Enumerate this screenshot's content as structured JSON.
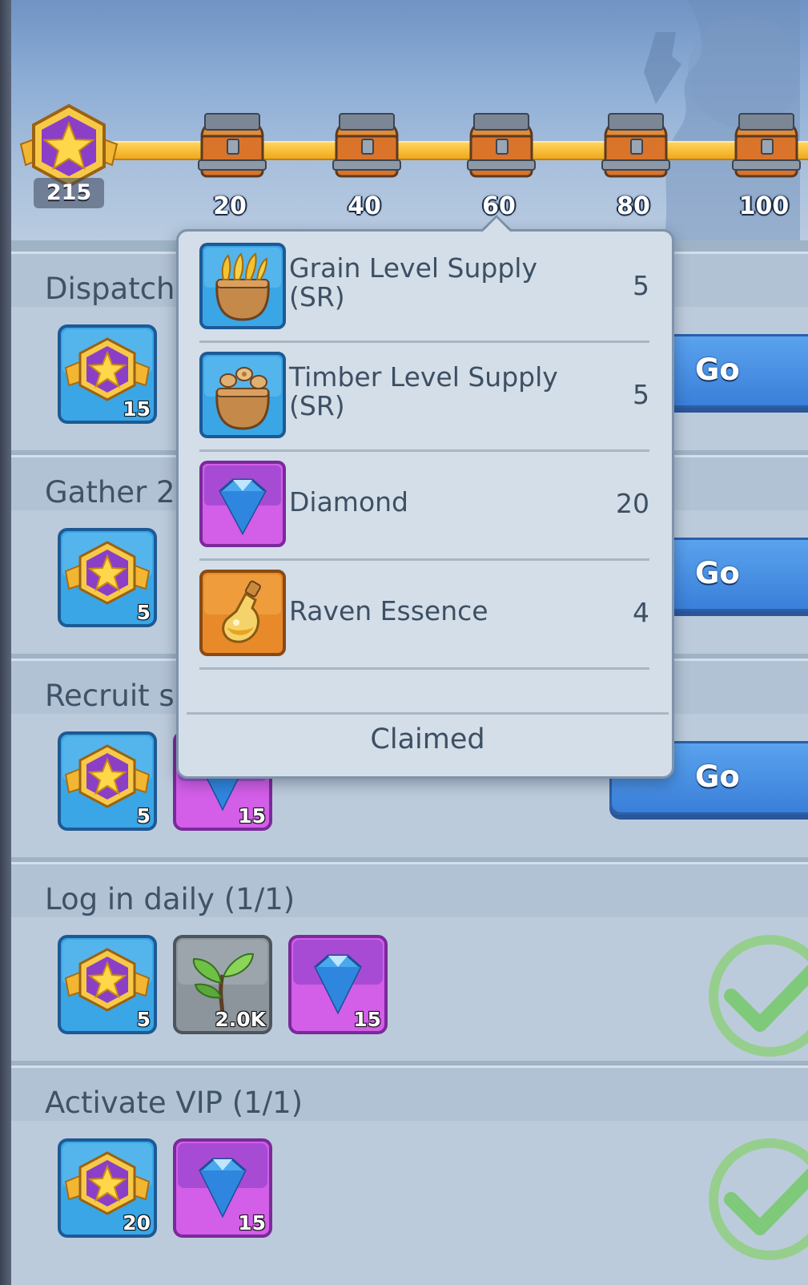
{
  "header": {
    "points": "215",
    "milestones": [
      {
        "label": "20"
      },
      {
        "label": "40"
      },
      {
        "label": "60"
      },
      {
        "label": "80"
      },
      {
        "label": "100"
      }
    ]
  },
  "tasks": [
    {
      "title": "Dispatch",
      "rewards": [
        {
          "icon": "star-medal-icon",
          "count": "15"
        }
      ],
      "action": "Go"
    },
    {
      "title": "Gather 2(",
      "rewards": [
        {
          "icon": "star-medal-icon",
          "count": "5"
        }
      ],
      "action": "Go"
    },
    {
      "title": "Recruit s",
      "rewards": [
        {
          "icon": "star-medal-icon",
          "count": "5"
        },
        {
          "icon": "diamond-icon",
          "count": "15"
        }
      ],
      "action": "Go"
    },
    {
      "title": "Log in daily (1/1)",
      "rewards": [
        {
          "icon": "star-medal-icon",
          "count": "5"
        },
        {
          "icon": "sprout-icon",
          "count": "2.0K"
        },
        {
          "icon": "diamond-icon",
          "count": "15"
        }
      ],
      "status": "completed"
    },
    {
      "title": "Activate VIP (1/1)",
      "rewards": [
        {
          "icon": "star-medal-icon",
          "count": "20"
        },
        {
          "icon": "diamond-icon",
          "count": "15"
        }
      ],
      "status": "completed"
    }
  ],
  "popup": {
    "items": [
      {
        "name": "Grain Level Supply (SR)",
        "line1": "Grain Level Supply",
        "line2": "(SR)",
        "qty": "5",
        "icon": "grain-sack-icon"
      },
      {
        "name": "Timber Level Supply (SR)",
        "line1": "Timber Level Supply",
        "line2": "(SR)",
        "qty": "5",
        "icon": "timber-sack-icon"
      },
      {
        "name": "Diamond",
        "line1": "Diamond",
        "qty": "20",
        "icon": "diamond-icon"
      },
      {
        "name": "Raven Essence",
        "line1": "Raven Essence",
        "qty": "4",
        "icon": "potion-bottle-icon"
      }
    ],
    "status": "Claimed"
  },
  "colors": {
    "go_button": "#3a7fd9",
    "progress_bar": "#f0a91c",
    "diamond_tile": "#d35ee8",
    "medal_tile": "#3aa6e6",
    "check": "#7fc97a"
  }
}
